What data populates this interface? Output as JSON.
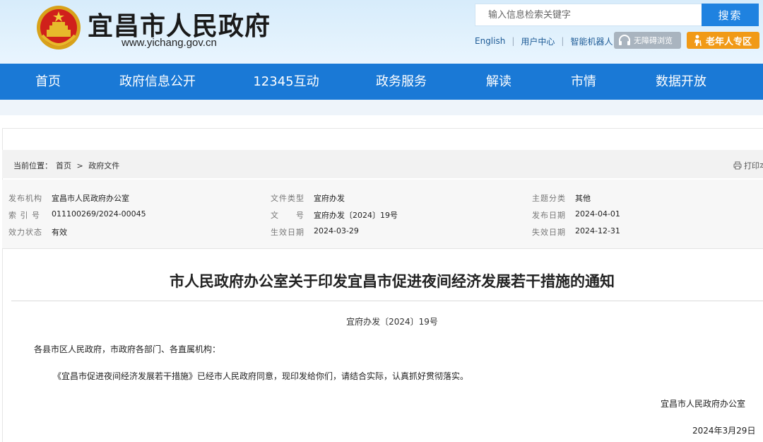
{
  "header": {
    "site_title": "宜昌市人民政府",
    "site_url": "www.yichang.gov.cn",
    "search_placeholder": "输入信息检索关键字",
    "search_button": "搜索",
    "links": [
      "English",
      "用户中心",
      "智能机器人"
    ],
    "accessibility_button": "无障碍浏览",
    "elder_button": "老年人专区",
    "colors": {
      "accent": "#1a79d6",
      "elder": "#f19a17",
      "access": "#a9b4bf"
    }
  },
  "nav": {
    "items": [
      "首页",
      "政府信息公开",
      "12345互动",
      "政务服务",
      "解读",
      "市情",
      "数据开放"
    ]
  },
  "breadcrumb": {
    "label": "当前位置：",
    "items": [
      "首页",
      ">",
      "政府文件"
    ],
    "print": "打印本页"
  },
  "meta": {
    "rows": [
      [
        {
          "k": "发布机构",
          "v": "宜昌市人民政府办公室"
        },
        {
          "k": "文件类型",
          "v": "宜府办发"
        },
        {
          "k": "主题分类",
          "v": "其他"
        }
      ],
      [
        {
          "k": "索 引 号",
          "v": "011100269/2024-00045"
        },
        {
          "k": "文　　号",
          "v": "宜府办发〔2024〕19号"
        },
        {
          "k": "发布日期",
          "v": "2024-04-01"
        }
      ],
      [
        {
          "k": "效力状态",
          "v": "有效"
        },
        {
          "k": "生效日期",
          "v": "2024-03-29"
        },
        {
          "k": "失效日期",
          "v": "2024-12-31"
        }
      ]
    ]
  },
  "document": {
    "title": "市人民政府办公室关于印发宜昌市促进夜间经济发展若干措施的通知",
    "number": "宜府办发〔2024〕19号",
    "recipients": "各县市区人民政府，市政府各部门、各直属机构：",
    "body": "《宜昌市促进夜间经济发展若干措施》已经市人民政府同意，现印发给你们，请结合实际，认真抓好贯彻落实。",
    "signature": "宜昌市人民政府办公室",
    "date": "2024年3月29日"
  }
}
